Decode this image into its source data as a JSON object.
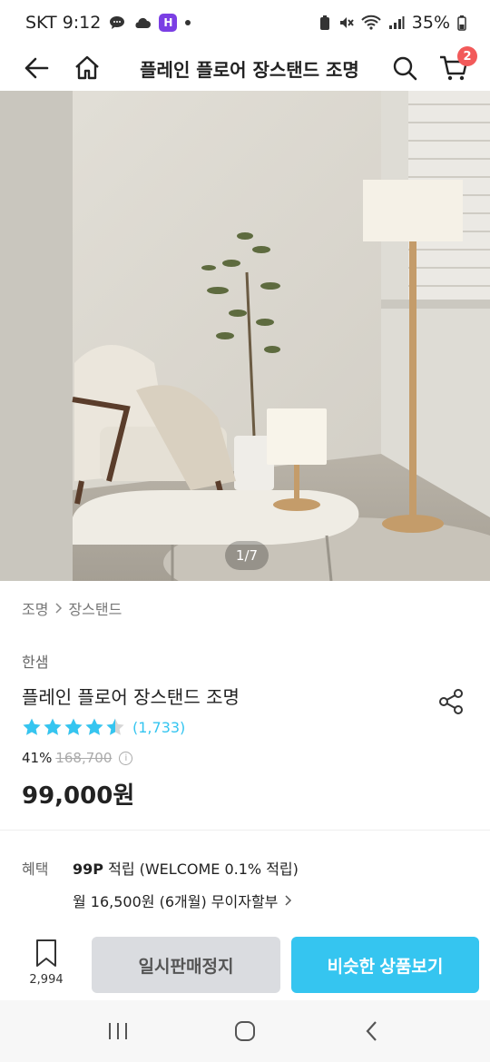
{
  "status_bar": {
    "carrier_time": "SKT 9:12",
    "app_badge": "H",
    "battery": "35%"
  },
  "header": {
    "title": "플레인 플로어 장스탠드 조명",
    "cart_count": "2"
  },
  "hero": {
    "pager": "1/7"
  },
  "breadcrumb": {
    "level1": "조명",
    "level2": "장스탠드"
  },
  "product": {
    "brand": "한샘",
    "name": "플레인 플로어 장스탠드 조명",
    "rating": 4.5,
    "review_count": "(1,733)",
    "discount": "41%",
    "original_price": "168,700",
    "price": "99,000원"
  },
  "benefit": {
    "label": "혜택",
    "points": "99P",
    "points_suffix": "적립 (WELCOME 0.1% 적립)",
    "installment": "월 16,500원 (6개월) 무이자할부"
  },
  "actions": {
    "bookmark_count": "2,994",
    "soldout_label": "일시판매정지",
    "similar_label": "비슷한 상품보기"
  },
  "colors": {
    "accent": "#35c5f0",
    "cart_badge": "#f25a5a",
    "disabled_button": "#dadce0"
  }
}
